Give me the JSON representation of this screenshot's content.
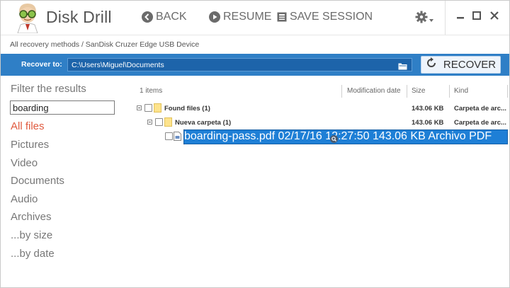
{
  "app": {
    "title": "Disk Drill"
  },
  "toolbar": {
    "back_label": "BACK",
    "resume_label": "RESUME",
    "save_label": "SAVE SESSION"
  },
  "breadcrumb": {
    "text": "All recovery methods / SanDisk Cruzer Edge USB Device"
  },
  "recover": {
    "label": "Recover to:",
    "path": "C:\\Users\\Miguel\\Documents",
    "button_label": "RECOVER"
  },
  "filters": {
    "title": "Filter the results",
    "search_value": "boarding",
    "items": [
      "All files",
      "Pictures",
      "Video",
      "Documents",
      "Audio",
      "Archives",
      "...by size",
      "...by date"
    ],
    "active": "All files"
  },
  "list": {
    "count_label": "1 items",
    "columns": {
      "date": "Modification date",
      "size": "Size",
      "kind": "Kind"
    },
    "rows": [
      {
        "name": "Found files (1)",
        "date": "",
        "size": "143.06 KB",
        "kind": "Carpeta de arc..."
      },
      {
        "name": "Nueva carpeta (1)",
        "date": "",
        "size": "143.06 KB",
        "kind": "Carpeta de arc..."
      },
      {
        "name": "boarding-pass.pdf",
        "date": "02/17/16 12:27:50",
        "size": "143.06 KB",
        "kind": "Archivo PDF"
      }
    ]
  },
  "colors": {
    "accent_blue": "#2f7fc6",
    "selection": "#1e7fd6",
    "active_filter": "#e05a3f"
  }
}
